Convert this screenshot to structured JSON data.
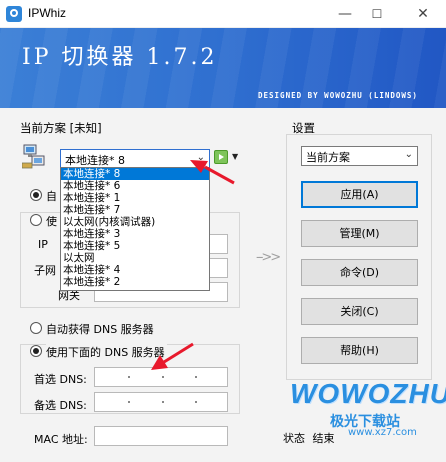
{
  "window": {
    "title": "IPWhiz",
    "minimize": "—",
    "maximize": "☐",
    "close": "✕"
  },
  "banner": {
    "title": "IP 切换器 1.7.2",
    "credit": "DESIGNED BY WOWOZHU (LINDOWS)"
  },
  "left": {
    "group_title": "当前方案 [未知]",
    "adapter_value": "本地连接* 8",
    "ip_auto_label": "自",
    "ip_manual_label": "使",
    "ip_label": "IP",
    "mask_label": "子网",
    "gateway_label": "网关",
    "dns_auto_label": "自动获得 DNS 服务器",
    "dns_manual_label": "使用下面的 DNS 服务器",
    "dns_primary_label": "首选 DNS:",
    "dns_secondary_label": "备选 DNS:",
    "mac_label": "MAC 地址:"
  },
  "dropdown": {
    "items": [
      "本地连接* 8",
      "本地连接* 6",
      "本地连接* 1",
      "本地连接* 7",
      "以太网(内核调试器)",
      "本地连接* 3",
      "本地连接* 5",
      "以太网",
      "本地连接* 4",
      "本地连接* 2"
    ],
    "selected_index": 0
  },
  "right": {
    "group_title": "设置",
    "scheme_value": "当前方案",
    "buttons": [
      "应用(A)",
      "管理(M)",
      "命令(D)",
      "关闭(C)",
      "帮助(H)"
    ]
  },
  "middle_arrow": "-->>",
  "status": {
    "label": "状态",
    "value": "结束"
  },
  "watermark": {
    "brand": "WOWOZHU",
    "cn": "极光下载站",
    "url": "www.xz7.com"
  },
  "colors": {
    "banner": "#2f6fd0",
    "selection": "#0078d7",
    "annotation_arrow": "#e8192c"
  }
}
